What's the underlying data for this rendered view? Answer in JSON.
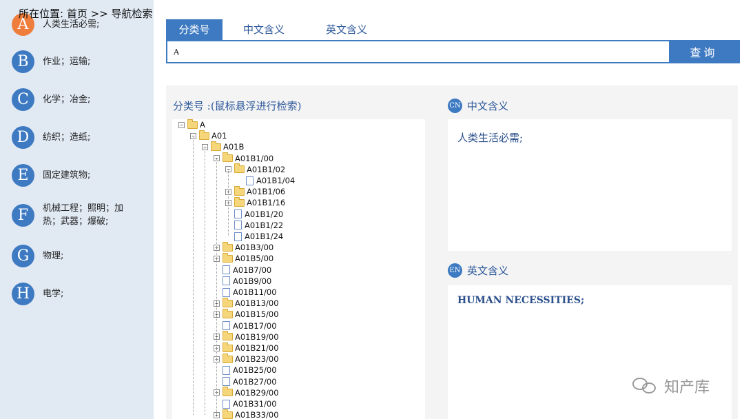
{
  "breadcrumb": "所在位置: 首页 >> 导航检索",
  "categories": [
    {
      "letter": "A",
      "label": "人类生活必需;"
    },
    {
      "letter": "B",
      "label": "作业；运输;"
    },
    {
      "letter": "C",
      "label": "化学；冶金;"
    },
    {
      "letter": "D",
      "label": "纺织；造纸;"
    },
    {
      "letter": "E",
      "label": "固定建筑物;"
    },
    {
      "letter": "F",
      "label": "机械工程；照明；加热；武器；爆破;"
    },
    {
      "letter": "G",
      "label": "物理;"
    },
    {
      "letter": "H",
      "label": "电学;"
    }
  ],
  "search": {
    "tabs": [
      "分类号",
      "中文含义",
      "英文含义"
    ],
    "value": "A",
    "button": "查询"
  },
  "tree_panel": {
    "title": "分类号 :(鼠标悬浮进行检索)",
    "nodes": [
      {
        "label": "A",
        "type": "folder",
        "state": "open",
        "level": 0
      },
      {
        "label": "A01",
        "type": "folder",
        "state": "open",
        "level": 1
      },
      {
        "label": "A01B",
        "type": "folder",
        "state": "open",
        "level": 2
      },
      {
        "label": "A01B1/00",
        "type": "folder",
        "state": "open",
        "level": 3
      },
      {
        "label": "A01B1/02",
        "type": "folder",
        "state": "open",
        "level": 4
      },
      {
        "label": "A01B1/04",
        "type": "doc",
        "state": "",
        "level": 5
      },
      {
        "label": "A01B1/06",
        "type": "folder",
        "state": "closed",
        "level": 4
      },
      {
        "label": "A01B1/16",
        "type": "folder",
        "state": "closed",
        "level": 4
      },
      {
        "label": "A01B1/20",
        "type": "doc",
        "state": "",
        "level": 4
      },
      {
        "label": "A01B1/22",
        "type": "doc",
        "state": "",
        "level": 4
      },
      {
        "label": "A01B1/24",
        "type": "doc",
        "state": "",
        "level": 4
      },
      {
        "label": "A01B3/00",
        "type": "folder",
        "state": "closed",
        "level": 3
      },
      {
        "label": "A01B5/00",
        "type": "folder",
        "state": "closed",
        "level": 3
      },
      {
        "label": "A01B7/00",
        "type": "doc",
        "state": "",
        "level": 3
      },
      {
        "label": "A01B9/00",
        "type": "doc",
        "state": "",
        "level": 3
      },
      {
        "label": "A01B11/00",
        "type": "doc",
        "state": "",
        "level": 3
      },
      {
        "label": "A01B13/00",
        "type": "folder",
        "state": "closed",
        "level": 3
      },
      {
        "label": "A01B15/00",
        "type": "folder",
        "state": "closed",
        "level": 3
      },
      {
        "label": "A01B17/00",
        "type": "doc",
        "state": "",
        "level": 3
      },
      {
        "label": "A01B19/00",
        "type": "folder",
        "state": "closed",
        "level": 3
      },
      {
        "label": "A01B21/00",
        "type": "folder",
        "state": "closed",
        "level": 3
      },
      {
        "label": "A01B23/00",
        "type": "folder",
        "state": "closed",
        "level": 3
      },
      {
        "label": "A01B25/00",
        "type": "doc",
        "state": "",
        "level": 3
      },
      {
        "label": "A01B27/00",
        "type": "doc",
        "state": "",
        "level": 3
      },
      {
        "label": "A01B29/00",
        "type": "folder",
        "state": "closed",
        "level": 3
      },
      {
        "label": "A01B31/00",
        "type": "doc",
        "state": "",
        "level": 3
      },
      {
        "label": "A01B33/00",
        "type": "folder",
        "state": "closed",
        "level": 3
      }
    ]
  },
  "cn_panel": {
    "badge": "CN",
    "title": "中文含义",
    "text": "人类生活必需;"
  },
  "en_panel": {
    "badge": "EN",
    "title": "英文含义",
    "text": "HUMAN NECESSITIES;"
  },
  "watermark": "知产库",
  "colors": {
    "accent": "#3d7ac2",
    "active": "#ef7d3c",
    "sidebar_bg": "#e1e9f3"
  }
}
